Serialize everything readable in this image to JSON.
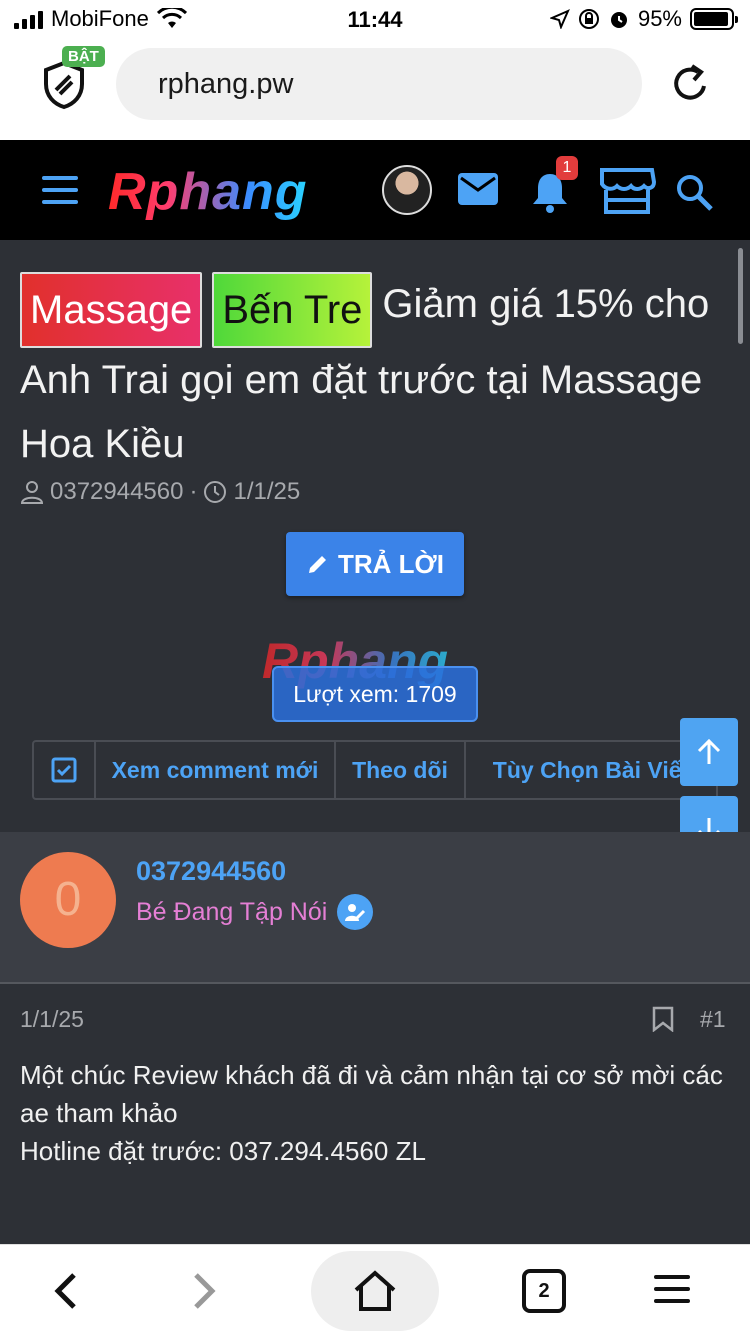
{
  "status_bar": {
    "carrier": "MobiFone",
    "time": "11:44",
    "battery": "95%",
    "battery_level": 0.95
  },
  "browser": {
    "url": "rphang.pw",
    "shield_badge": "BẬT"
  },
  "header": {
    "logo": "Rphang",
    "notification_count": "1",
    "accent_color": "#4da3f5"
  },
  "thread": {
    "tags": [
      "Massage",
      "Bến Tre"
    ],
    "title": "Giảm giá 15% cho Anh Trai gọi em đặt trước tại Massage Hoa Kiều",
    "author": "0372944560",
    "separator": "·",
    "date": "1/1/25",
    "reply_label": "TRẢ LỜI",
    "watermark_logo": "Rphang",
    "views_label": "Lượt xem: 1709",
    "options": {
      "new_comments": "Xem comment mới",
      "follow": "Theo dõi",
      "more": "Tùy Chọn Bài Viết"
    }
  },
  "post": {
    "avatar_letter": "0",
    "username": "0372944560",
    "user_title": "Bé Đang Tập Nói",
    "date": "1/1/25",
    "number": "#1",
    "body_lines": [
      "Một chúc Review khách đã đi và cảm nhận tại cơ sở mời các ae tham khảo",
      "Hotline đặt trước: 037.294.4560 ZL"
    ]
  },
  "toolbar": {
    "tab_count": "2"
  }
}
